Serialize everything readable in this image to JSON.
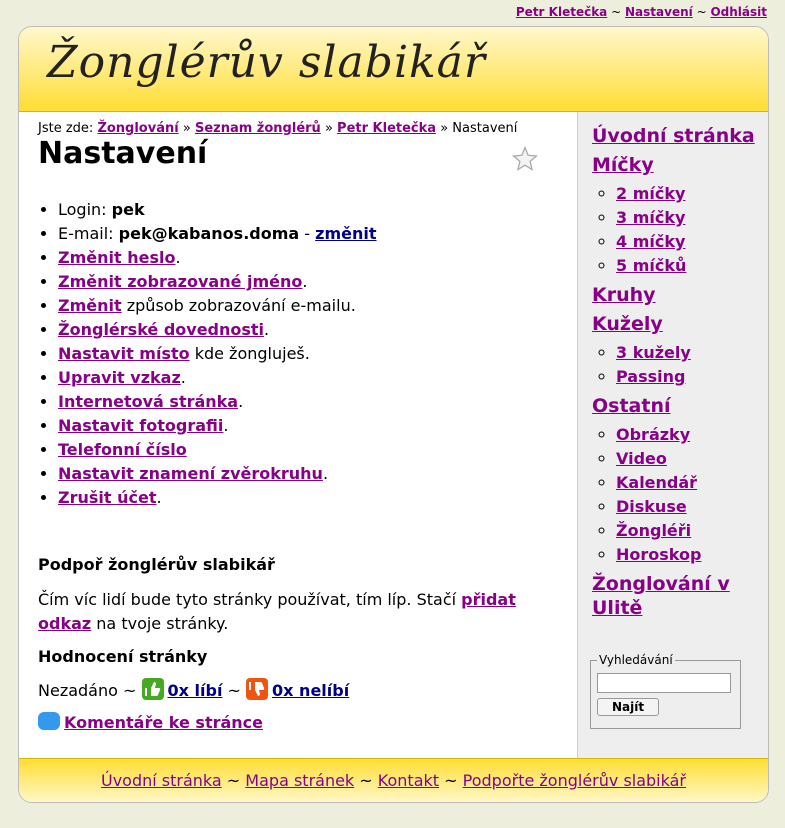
{
  "top_links": {
    "user": "Petr Kletečka",
    "sep1": "~",
    "settings": "Nastavení",
    "sep2": "~",
    "logout": "Odhlásit"
  },
  "site": {
    "logo": "Žonglérův slabikář"
  },
  "breadcrumb": {
    "prefix": "Jste zde:",
    "items": [
      "Žonglování",
      "Seznam žonglérů",
      "Petr Kletečka"
    ],
    "sep": "»",
    "current": "Nastavení"
  },
  "page_title": "Nastavení",
  "settings": {
    "login_label": "Login:",
    "login_value": "pek",
    "email_label": "E-mail:",
    "email_value": "pek@kabanos.doma",
    "email_dash": "-",
    "email_change": "změnit",
    "items": [
      {
        "link": "Změnit heslo",
        "rest": "."
      },
      {
        "link": "Změnit zobrazované jméno",
        "rest": "."
      },
      {
        "link": "Změnit",
        "rest": " způsob zobrazování e-mailu."
      },
      {
        "link": "Žonglérské dovednosti",
        "rest": "."
      },
      {
        "link": "Nastavit místo",
        "rest": " kde žongluješ."
      },
      {
        "link": "Upravit vzkaz",
        "rest": "."
      },
      {
        "link": "Internetová stránka",
        "rest": "."
      },
      {
        "link": "Nastavit fotografii",
        "rest": "."
      },
      {
        "link": "Telefonní číslo",
        "rest": ""
      },
      {
        "link": "Nastavit znamení zvěrokruhu",
        "rest": "."
      },
      {
        "link": "Zrušit účet",
        "rest": "."
      }
    ]
  },
  "support": {
    "heading": "Podpoř žonglérův slabikář",
    "text_before": "Čím víc lidí bude tyto stránky používat, tím líp. Stačí ",
    "link": "přidat odkaz",
    "text_after": " na tvoje stránky."
  },
  "rating": {
    "heading": "Hodnocení stránky",
    "status": "Nezadáno",
    "sep": "~",
    "like": "0x líbí",
    "dislike": "0x nelíbí"
  },
  "comments": {
    "label": "Komentáře ke stránce"
  },
  "sidebar": {
    "sections": [
      {
        "title": "Úvodní stránka",
        "items": []
      },
      {
        "title": "Míčky",
        "items": [
          "2 míčky",
          "3 míčky",
          "4 míčky",
          "5 míčků"
        ]
      },
      {
        "title": "Kruhy",
        "items": []
      },
      {
        "title": "Kužely",
        "items": [
          "3 kužely",
          "Passing"
        ]
      },
      {
        "title": "Ostatní",
        "items": [
          "Obrázky",
          "Video",
          "Kalendář",
          "Diskuse",
          "Žongléři",
          "Horoskop"
        ]
      },
      {
        "title": "Žonglování v Ulitě",
        "items": []
      }
    ],
    "search": {
      "legend": "Vyhledávání",
      "value": "",
      "button": "Najít"
    }
  },
  "footer": {
    "links": [
      "Úvodní stránka",
      "Mapa stránek",
      "Kontakt",
      "Podpořte žonglérův slabikář"
    ],
    "sep": "~"
  },
  "colors": {
    "link": "#880088",
    "link_blue": "#000088",
    "header_yellow": "#ffdd33",
    "like": "#44aa22",
    "dislike": "#ee5511"
  }
}
